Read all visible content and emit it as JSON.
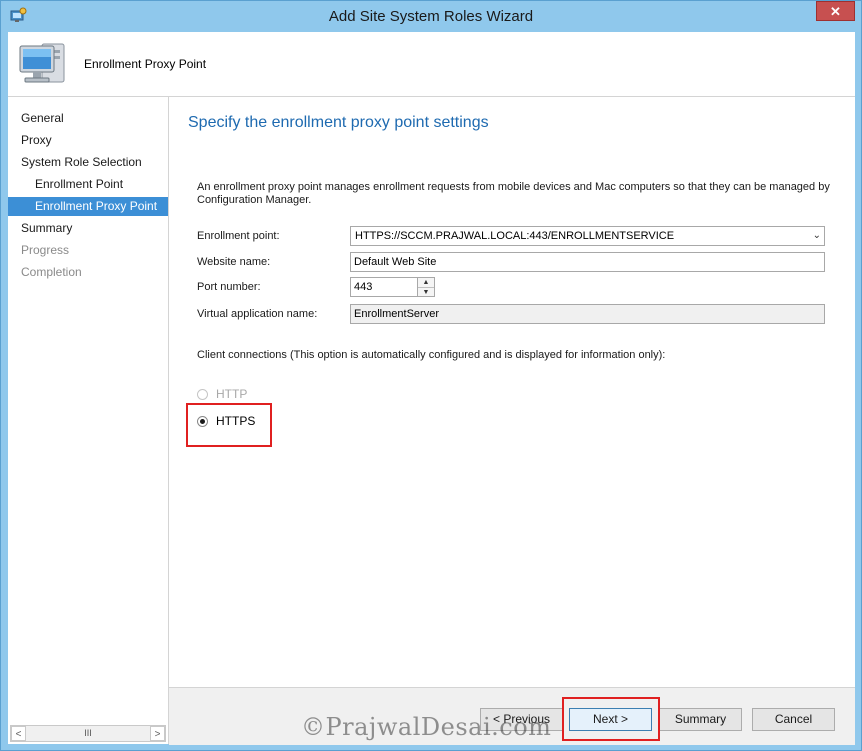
{
  "window": {
    "title": "Add Site System Roles Wizard",
    "close_glyph": "✕",
    "icon": "wizard-icon"
  },
  "header": {
    "title": "Enrollment Proxy Point",
    "icon": "computer-monitor-icon"
  },
  "sidebar": {
    "items": [
      {
        "label": "General",
        "state": "normal",
        "level": 0
      },
      {
        "label": "Proxy",
        "state": "normal",
        "level": 0
      },
      {
        "label": "System Role Selection",
        "state": "normal",
        "level": 0
      },
      {
        "label": "Enrollment Point",
        "state": "normal",
        "level": 1
      },
      {
        "label": "Enrollment Proxy Point",
        "state": "active",
        "level": 1
      },
      {
        "label": "Summary",
        "state": "normal",
        "level": 0
      },
      {
        "label": "Progress",
        "state": "disabled",
        "level": 0
      },
      {
        "label": "Completion",
        "state": "disabled",
        "level": 0
      }
    ],
    "scroll_left": "<",
    "scroll_thumb": "III",
    "scroll_right": ">"
  },
  "main": {
    "heading": "Specify the enrollment proxy point settings",
    "description": "An enrollment proxy point manages enrollment requests from mobile devices and Mac computers so that they can be managed by Configuration Manager.",
    "fields": {
      "enrollment_point": {
        "label": "Enrollment point:",
        "value": "HTTPS://SCCM.PRAJWAL.LOCAL:443/ENROLLMENTSERVICE",
        "dropdown_glyph": "⌄"
      },
      "website_name": {
        "label": "Website name:",
        "value": "Default Web Site"
      },
      "port_number": {
        "label": "Port number:",
        "value": "443",
        "up_glyph": "▲",
        "down_glyph": "▼"
      },
      "virtual_app_name": {
        "label": "Virtual application name:",
        "value": "EnrollmentServer"
      }
    },
    "client_connections": {
      "label": "Client connections (This option is automatically configured and is displayed for information only):",
      "options": [
        {
          "label": "HTTP",
          "selected": false,
          "disabled": true
        },
        {
          "label": "HTTPS",
          "selected": true,
          "disabled": false
        }
      ]
    }
  },
  "footer": {
    "previous": "< Previous",
    "next": "Next >",
    "summary": "Summary",
    "cancel": "Cancel"
  },
  "watermark": "©PrajwalDesai.com",
  "colors": {
    "frame": "#8fc8ec",
    "active_nav": "#3c8fd6",
    "heading": "#1e6ab0",
    "highlight": "#e02020"
  }
}
